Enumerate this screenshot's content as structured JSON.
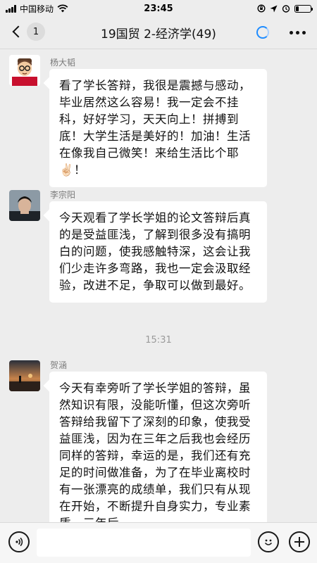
{
  "status_bar": {
    "carrier": "中国移动",
    "time": "23:45"
  },
  "nav": {
    "unread_count": "1",
    "title": "19国贸 2-经济学(49)"
  },
  "messages": [
    {
      "sender": "杨大韬",
      "text": "看了学长答辩，我很是震撼与感动，毕业居然这么容易！我一定会不挂科，好好学习，天天向上！拼搏到底！大学生活是美好的！加油！生活在像我自己微笑！来给生活比个耶✌🏻！"
    },
    {
      "sender": "李宗阳",
      "text": "今天观看了学长学姐的论文答辩后真的是受益匪浅，了解到很多没有搞明白的问题，使我感触特深，这会让我们少走许多弯路，我也一定会汲取经验，改进不足，争取可以做到最好。"
    },
    {
      "type": "time",
      "text": "15:31"
    },
    {
      "sender": "贺涵",
      "text": "今天有幸旁听了学长学姐的答辩，虽然知识有限，没能听懂，但这次旁听答辩给我留下了深刻的印象，使我受益匪浅，因为在三年之后我也会经历同样的答辩，幸运的是，我们还有充足的时间做准备，为了在毕业离校时有一张漂亮的成绩单，我们只有从现在开始，不断提升自身实力，专业素质，三年后"
    }
  ],
  "input": {
    "placeholder": ""
  },
  "colors": {
    "background": "#EDEDED",
    "bubble": "#FFFFFF",
    "accent": "#1E8CFF"
  }
}
